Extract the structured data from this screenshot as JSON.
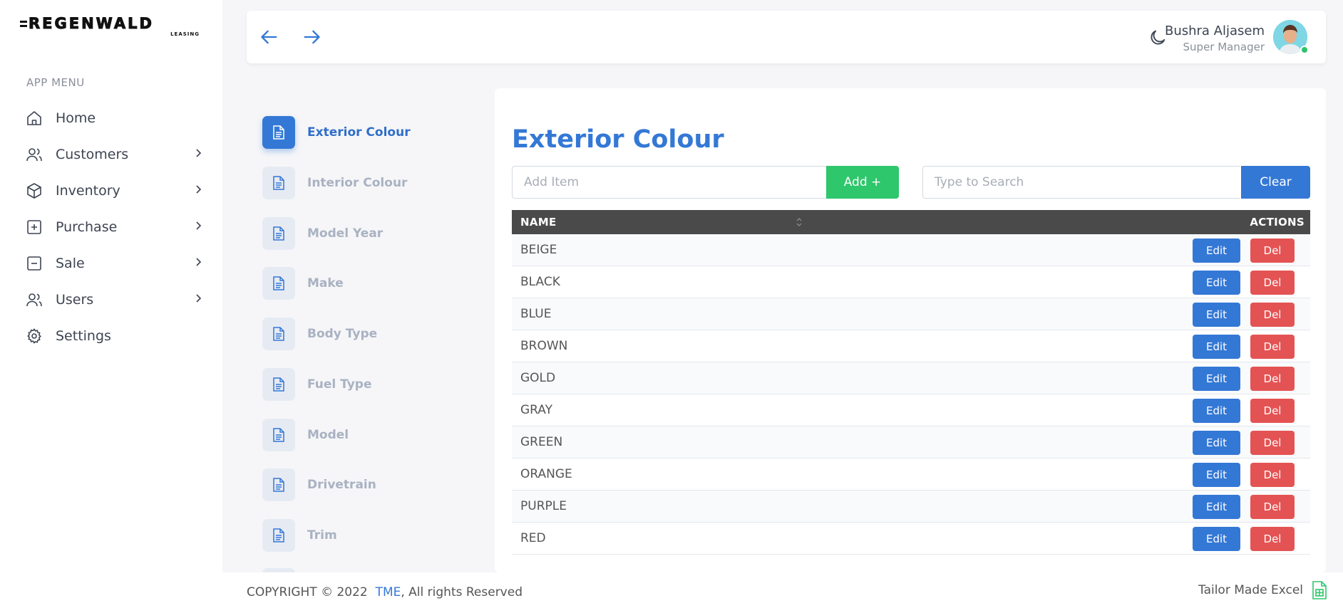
{
  "brand": {
    "name": "REGENWALD",
    "sub": "LEASING"
  },
  "sidebar": {
    "heading": "APP MENU",
    "items": [
      {
        "label": "Home",
        "icon": "home-icon",
        "has_children": false
      },
      {
        "label": "Customers",
        "icon": "users-icon",
        "has_children": true
      },
      {
        "label": "Inventory",
        "icon": "box-icon",
        "has_children": true
      },
      {
        "label": "Purchase",
        "icon": "plus-square-icon",
        "has_children": true
      },
      {
        "label": "Sale",
        "icon": "minus-square-icon",
        "has_children": true
      },
      {
        "label": "Users",
        "icon": "users-icon",
        "has_children": true
      },
      {
        "label": "Settings",
        "icon": "gear-icon",
        "has_children": false
      }
    ]
  },
  "topbar": {
    "user_name": "Bushra Aljasem",
    "user_role": "Super Manager"
  },
  "subnav": {
    "items": [
      {
        "label": "Exterior Colour",
        "active": true
      },
      {
        "label": "Interior Colour",
        "active": false
      },
      {
        "label": "Model Year",
        "active": false
      },
      {
        "label": "Make",
        "active": false
      },
      {
        "label": "Body Type",
        "active": false
      },
      {
        "label": "Fuel Type",
        "active": false
      },
      {
        "label": "Model",
        "active": false
      },
      {
        "label": "Drivetrain",
        "active": false
      },
      {
        "label": "Trim",
        "active": false
      }
    ]
  },
  "main": {
    "title": "Exterior Colour",
    "add_placeholder": "Add Item",
    "add_label": "Add +",
    "search_placeholder": "Type to Search",
    "clear_label": "Clear",
    "table": {
      "columns": [
        "NAME",
        "ACTIONS"
      ],
      "rows": [
        "BEIGE",
        "BLACK",
        "BLUE",
        "BROWN",
        "GOLD",
        "GRAY",
        "GREEN",
        "ORANGE",
        "PURPLE",
        "RED"
      ],
      "edit_label": "Edit",
      "del_label": "Del"
    }
  },
  "footer": {
    "copyright_prefix": "COPYRIGHT © 2022",
    "copyright_link": "TME",
    "copyright_suffix": ", All rights Reserved",
    "right_text": "Tailor Made Excel"
  },
  "colors": {
    "primary": "#3478d6",
    "success": "#2ec76b",
    "danger": "#e45353",
    "table_header": "#4a4a4a"
  }
}
